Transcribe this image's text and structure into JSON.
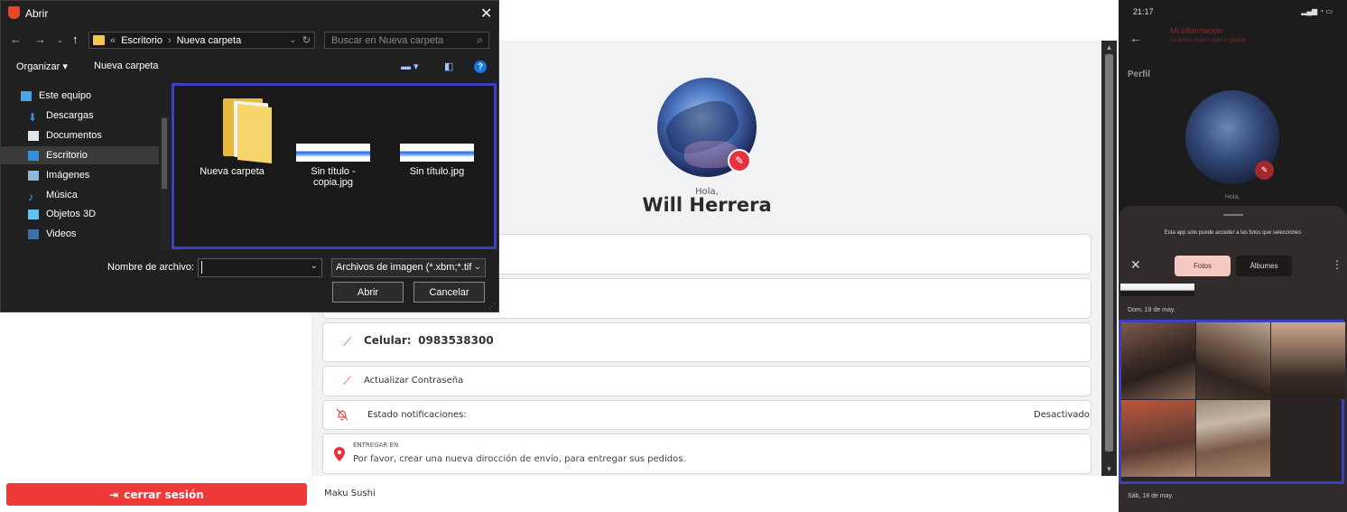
{
  "dialog": {
    "title": "Abrir",
    "breadcrumb_sep": "«",
    "breadcrumb": [
      "Escritorio",
      "Nueva carpeta"
    ],
    "search_placeholder": "Buscar en Nueva carpeta",
    "toolbar": {
      "organize": "Organizar ▾",
      "new_folder": "Nueva carpeta"
    },
    "sidebar": [
      {
        "label": "Este equipo",
        "icon": "computer-icon"
      },
      {
        "label": "Descargas",
        "icon": "download-icon"
      },
      {
        "label": "Documentos",
        "icon": "documents-icon"
      },
      {
        "label": "Escritorio",
        "icon": "desktop-icon"
      },
      {
        "label": "Imágenes",
        "icon": "pictures-icon"
      },
      {
        "label": "Música",
        "icon": "music-icon"
      },
      {
        "label": "Objetos 3D",
        "icon": "objects-3d-icon"
      },
      {
        "label": "Videos",
        "icon": "videos-icon"
      }
    ],
    "files": [
      {
        "name": "Nueva carpeta",
        "type": "folder"
      },
      {
        "name": "Sin título - copia.jpg",
        "type": "image"
      },
      {
        "name": "Sin título.jpg",
        "type": "image"
      }
    ],
    "filename_label": "Nombre de archivo:",
    "filename_value": "",
    "filetype": "Archivos de imagen (*.xbm;*.tif",
    "open_button": "Abrir",
    "cancel_button": "Cancelar"
  },
  "profile": {
    "greeting": "Hola,",
    "name": "Will Herrera",
    "phone_label": "Celular:",
    "phone_value": "0983538300",
    "update_password": "Actualizar Contraseña",
    "notifications_label": "Estado notificaciones:",
    "notifications_value": "Desactivado",
    "delivery_label": "ENTREGAR EN",
    "delivery_text": "Por favor, crear una nueva dirocción de envío, para entregar sus pedidos.",
    "logout": "cerrar sesión",
    "brand": "Maku Sushi"
  },
  "phone": {
    "time": "21:17",
    "title": "Mi información",
    "subtitle": "Lo tienes seguro para tu pedido",
    "section": "Perfil",
    "greeting": "Hola,",
    "notice": "Esta app solo puede acceder a las fotos que selecciones",
    "tab_photos": "Fotos",
    "tab_albums": "Álbumes",
    "date1": "Dom, 19 de may.",
    "date2": "Sáb, 18 de may."
  },
  "colors": {
    "accent_red": "#f03a3a",
    "highlight_blue": "#3b3fc1",
    "dialog_bg": "#202020"
  }
}
